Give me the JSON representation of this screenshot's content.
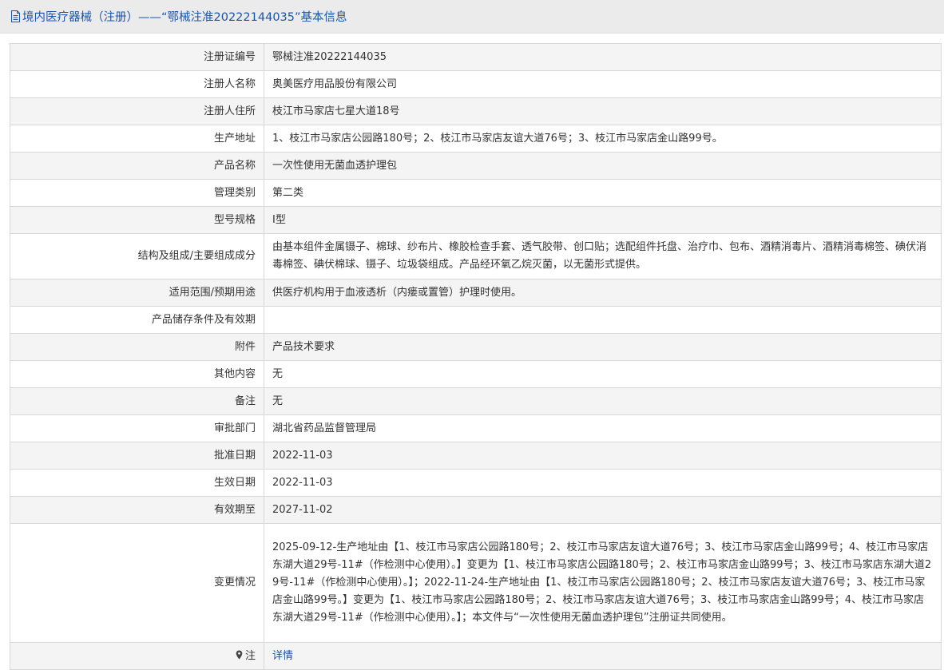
{
  "header": {
    "icon": "document-icon",
    "title": "境内医疗器械（注册）——“鄂械注准20222144035”基本信息"
  },
  "rows": [
    {
      "label": "注册证编号",
      "value": "鄂械注准20222144035"
    },
    {
      "label": "注册人名称",
      "value": "奥美医疗用品股份有限公司"
    },
    {
      "label": "注册人住所",
      "value": "枝江市马家店七星大道18号"
    },
    {
      "label": "生产地址",
      "value": "1、枝江市马家店公园路180号；2、枝江市马家店友谊大道76号；3、枝江市马家店金山路99号。"
    },
    {
      "label": "产品名称",
      "value": "一次性使用无菌血透护理包"
    },
    {
      "label": "管理类别",
      "value": "第二类"
    },
    {
      "label": "型号规格",
      "value": "Ⅰ型"
    },
    {
      "label": "结构及组成/主要组成成分",
      "value": "由基本组件金属镊子、棉球、纱布片、橡胶检查手套、透气胶带、创口贴；选配组件托盘、治疗巾、包布、酒精消毒片、酒精消毒棉签、碘伏消毒棉签、碘伏棉球、镊子、垃圾袋组成。产品经环氧乙烷灭菌，以无菌形式提供。"
    },
    {
      "label": "适用范围/预期用途",
      "value": "供医疗机构用于血液透析（内瘘或置管）护理时使用。"
    },
    {
      "label": "产品储存条件及有效期",
      "value": ""
    },
    {
      "label": "附件",
      "value": "产品技术要求"
    },
    {
      "label": "其他内容",
      "value": "无"
    },
    {
      "label": "备注",
      "value": "无"
    },
    {
      "label": "审批部门",
      "value": "湖北省药品监督管理局"
    },
    {
      "label": "批准日期",
      "value": "2022-11-03"
    },
    {
      "label": "生效日期",
      "value": "2022-11-03"
    },
    {
      "label": "有效期至",
      "value": "2027-11-02"
    },
    {
      "label": "变更情况",
      "value": "2025-09-12-生产地址由【1、枝江市马家店公园路180号；2、枝江市马家店友谊大道76号；3、枝江市马家店金山路99号；4、枝江市马家店东湖大道29号-11#（作检测中心使用）。】变更为【1、枝江市马家店公园路180号；2、枝江市马家店金山路99号；3、枝江市马家店东湖大道29号-11#（作检测中心使用）。】；2022-11-24-生产地址由【1、枝江市马家店公园路180号；2、枝江市马家店友谊大道76号；3、枝江市马家店金山路99号。】变更为【1、枝江市马家店公园路180号；2、枝江市马家店友谊大道76号；3、枝江市马家店金山路99号；4、枝江市马家店东湖大道29号-11#（作检测中心使用）。】；本文件与“一次性使用无菌血透护理包”注册证共同使用。"
    }
  ],
  "note": {
    "icon": "location-pin-icon",
    "label": "注",
    "link_text": "详情"
  }
}
